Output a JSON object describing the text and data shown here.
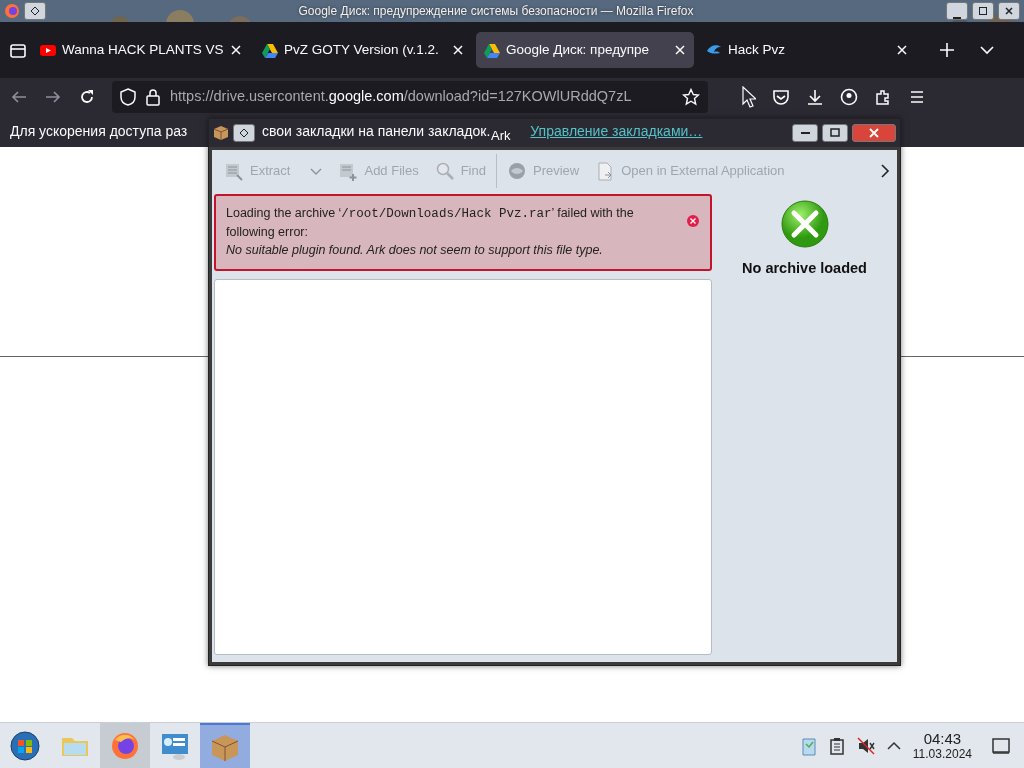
{
  "browser": {
    "title": "Google Диск: предупреждение системы безопасности — Mozilla Firefox",
    "tabs": [
      {
        "label": "Wanna HACK PLANTS VS",
        "selected": false
      },
      {
        "label": "PvZ GOTY Version (v.1.2.",
        "selected": false
      },
      {
        "label": "Google Диск: предупре",
        "selected": true
      },
      {
        "label": "Hack Pvz",
        "selected": false
      }
    ],
    "url": {
      "prefix": "https://drive.usercontent.",
      "domain": "google.com",
      "path": "/download?id=127KOWlURddQ7zL"
    },
    "notice": {
      "text_start": "Для ускорения доступа раз",
      "text_end": "свои закладки на панели закладок.",
      "link": "Управление закладками…"
    }
  },
  "ark": {
    "title": "Ark",
    "toolbar": [
      {
        "kind": "dropdown",
        "label": "Extract",
        "disabled": true
      },
      {
        "kind": "button",
        "label": "Add Files",
        "disabled": true
      },
      {
        "kind": "button",
        "label": "Find",
        "disabled": true
      },
      {
        "kind": "separator"
      },
      {
        "kind": "button",
        "label": "Preview",
        "disabled": true
      },
      {
        "kind": "button",
        "label": "Open in External Application",
        "disabled": true
      }
    ],
    "error": {
      "before": "Loading the archive ‘",
      "path": "/root/Downloads/Hack Pvz.rar",
      "after": "’ failed with the following error:",
      "detail": "No suitable plugin found. Ark does not seem to support this file type."
    },
    "info_label": "No archive loaded"
  },
  "taskbar": {
    "apps": [
      {
        "open": false,
        "selected": false
      },
      {
        "open": false,
        "selected": false
      },
      {
        "open": true,
        "selected": false
      },
      {
        "open": false,
        "selected": false
      },
      {
        "open": true,
        "selected": true
      }
    ],
    "time": "04:43",
    "date": "11.03.2024"
  }
}
